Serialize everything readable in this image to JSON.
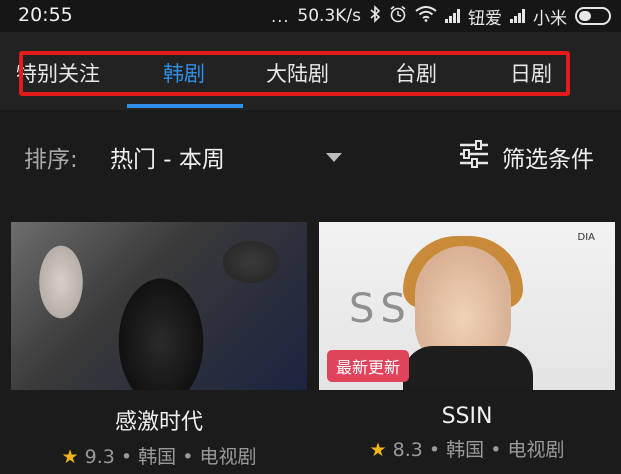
{
  "status_bar": {
    "time": "20:55",
    "dots": "...",
    "network_speed": "50.3K/s",
    "carrier1": "钮爱",
    "carrier2": "小米"
  },
  "tabs": [
    {
      "label": "特别关注",
      "active": false
    },
    {
      "label": "韩剧",
      "active": true
    },
    {
      "label": "大陆剧",
      "active": false
    },
    {
      "label": "台剧",
      "active": false
    },
    {
      "label": "日剧",
      "active": false
    }
  ],
  "sort": {
    "label": "排序:",
    "value": "热门 - 本周",
    "filter_label": "筛选条件"
  },
  "cards": [
    {
      "title": "感激时代",
      "star": "★",
      "rating": "9.3",
      "sep": "•",
      "region": "韩国",
      "type": "电视剧",
      "badge": ""
    },
    {
      "title": "SSIN",
      "star": "★",
      "rating": "8.3",
      "sep": "•",
      "region": "韩国",
      "type": "电视剧",
      "badge": "最新更新",
      "poster_text": "SS      IN",
      "poster_logo": "DIA"
    }
  ],
  "colors": {
    "accent": "#2e8fe6",
    "highlight": "#e21b1b",
    "badge": "#e0445b",
    "star": "#f0b41c"
  }
}
